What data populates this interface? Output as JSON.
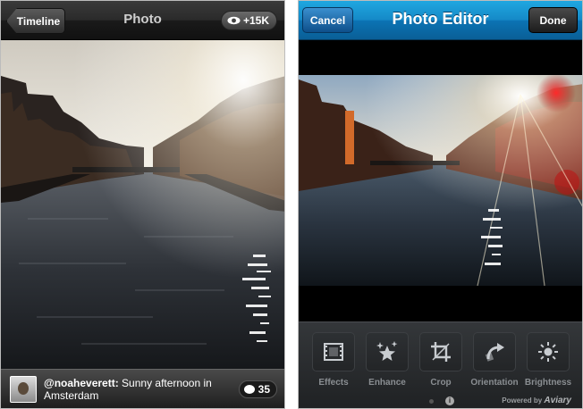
{
  "left_screen": {
    "nav": {
      "back_label": "Timeline",
      "title": "Photo",
      "views_count": "+15K"
    },
    "caption": {
      "username": "@noaheverett:",
      "text": " Sunny afternoon in Amsterdam",
      "comment_count": "35"
    },
    "icons": {
      "views": "eye-icon",
      "comments": "speech-bubble-icon",
      "avatar": "user-avatar"
    }
  },
  "right_screen": {
    "nav": {
      "cancel_label": "Cancel",
      "title": "Photo Editor",
      "done_label": "Done"
    },
    "tools": [
      {
        "label": "Effects",
        "icon": "film-frame-icon"
      },
      {
        "label": "Enhance",
        "icon": "sparkle-star-icon"
      },
      {
        "label": "Crop",
        "icon": "crop-icon"
      },
      {
        "label": "Orientation",
        "icon": "rotate-arrow-icon"
      },
      {
        "label": "Brightness",
        "icon": "sun-icon"
      }
    ],
    "footer": {
      "powered_by": "Powered by",
      "brand": "Aviary",
      "info": "i"
    },
    "colors": {
      "nav_blue": "#1589c7",
      "toolbar": "#2a2c2e"
    }
  }
}
